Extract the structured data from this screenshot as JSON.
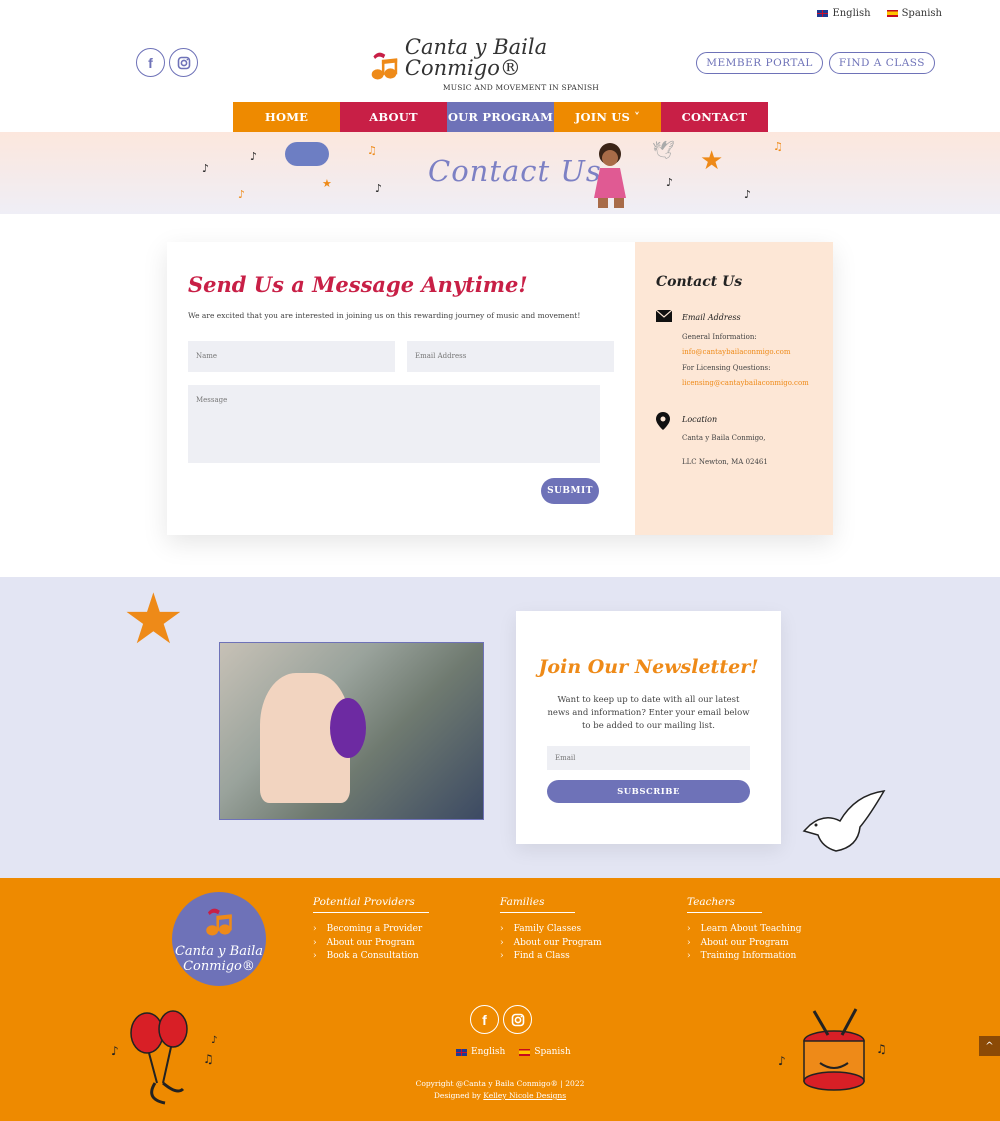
{
  "languages": [
    "English",
    "Spanish"
  ],
  "social": {
    "facebook": "f",
    "instagram": "◎"
  },
  "logo": {
    "name": "Canta y Baila Conmigo®",
    "tagline": "MUSIC AND MOVEMENT IN SPANISH"
  },
  "top_buttons": {
    "member_portal": "MEMBER PORTAL",
    "find_class": "FIND A CLASS"
  },
  "nav": [
    {
      "label": "HOME",
      "color": "#ee8a00"
    },
    {
      "label": "ABOUT",
      "color": "#c81f46"
    },
    {
      "label": "OUR PROGRAM",
      "color": "#6e72b8"
    },
    {
      "label": "JOIN US ˅",
      "color": "#ee8a00"
    },
    {
      "label": "CONTACT",
      "color": "#c81f46"
    }
  ],
  "banner": {
    "title": "Contact Us"
  },
  "form": {
    "title": "Send Us a Message Anytime!",
    "intro": "We are excited that you are interested in joining us on this rewarding journey of music and movement!",
    "name_placeholder": "Name",
    "email_placeholder": "Email Address",
    "message_placeholder": "Message",
    "submit": "SUBMIT"
  },
  "contact": {
    "title": "Contact Us",
    "email_head": "Email Address",
    "general_label": "General Information:",
    "general_email": "info@cantaybailaconmigo.com",
    "licensing_label": "For Licensing Questions:",
    "licensing_email": "licensing@cantaybailaconmigo.com",
    "location_head": "Location",
    "location_line1": "Canta y Baila Conmigo,",
    "location_line2": "LLC Newton, MA 02461"
  },
  "newsletter": {
    "title": "Join Our Newsletter!",
    "text": "Want to keep up to date with all our latest news and information? Enter your email below to be added to our mailing list.",
    "email_placeholder": "Email",
    "subscribe": "SUBSCRIBE"
  },
  "footer": {
    "logo_name": "Canta y Baila Conmigo®",
    "columns": [
      {
        "head": "Potential Providers",
        "links": [
          "Becoming a Provider",
          "About our Program",
          "Book a Consultation"
        ]
      },
      {
        "head": "Families",
        "links": [
          "Family Classes",
          "About our Program",
          "Find a Class"
        ]
      },
      {
        "head": "Teachers",
        "links": [
          "Learn About Teaching",
          "About our Program",
          "Training Information"
        ]
      }
    ],
    "copyright": "Copyright @Canta y Baila Conmigo® | 2022",
    "designed_prefix": "Designed by",
    "designer": "Kelley Nicole Designs"
  },
  "icons": {
    "scroll_top": "^"
  }
}
